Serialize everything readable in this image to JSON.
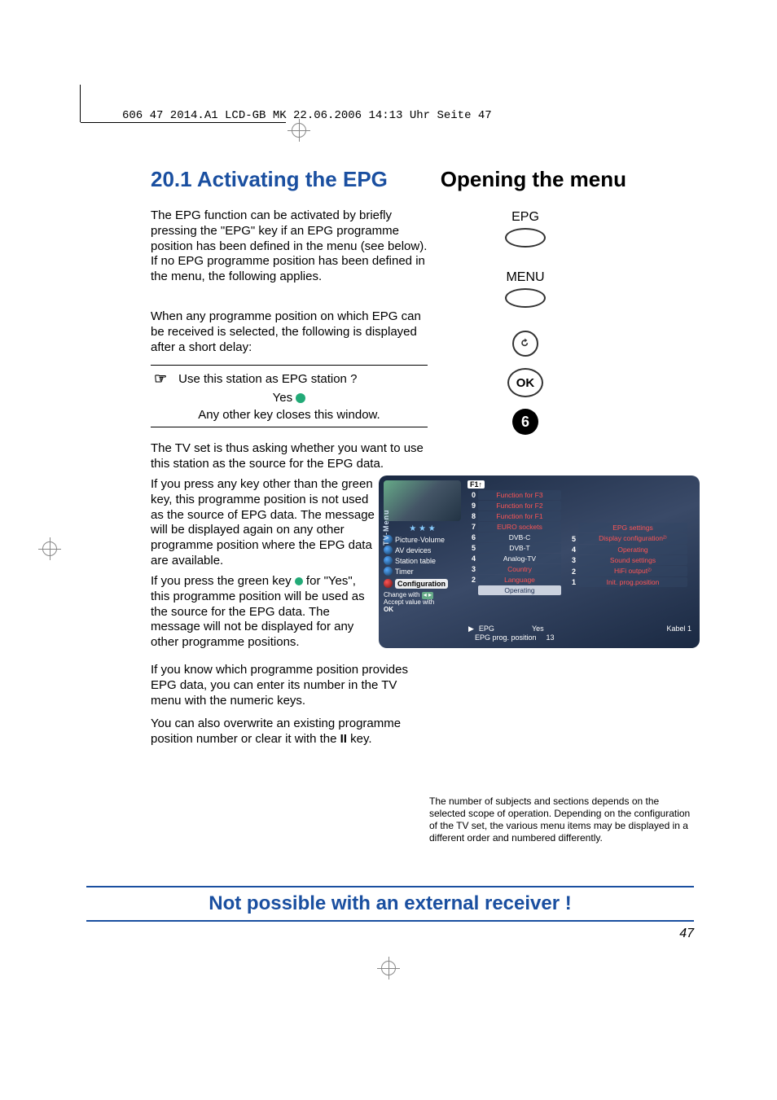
{
  "header_note": "606 47 2014.A1 LCD-GB  MK  22.06.2006  14:13 Uhr  Seite 47",
  "title": {
    "left": "20.1 Activating the EPG",
    "right": "Opening the menu"
  },
  "paragraphs": {
    "p1": "The EPG function can be activated by briefly pressing the \"EPG\" key if an EPG programme position has been defined in the menu (see below). If no EPG programme position has been defined in the menu, the following applies.",
    "p2": "When any programme position on which EPG can be received is selected, the following is displayed after a short delay:",
    "p3": "The TV set is thus asking whether you want to use this station as the source for the EPG data.",
    "p4": "If you press any key other than the green key, this programme position is not used as the source of EPG data. The message will be displayed again on any other programme position where the EPG data are available.",
    "p5_a": "If you press the green key ",
    "p5_b": " for \"Yes\", this programme position will be used as the source for the EPG data. The message will not be displayed for any other programme positions.",
    "p6": "If you know which programme position provides EPG data, you can enter its number in the TV menu with the numeric keys.",
    "p7_a": "You can also overwrite an existing programme position number or clear it with the ",
    "p7_b": "II",
    "p7_c": " key."
  },
  "callout": {
    "line1": "Use this station as EPG station ?",
    "line2": "Yes",
    "line3": "Any other key closes this window."
  },
  "side": {
    "epg_label": "EPG",
    "menu_label": "MENU",
    "ok": "OK",
    "number": "6"
  },
  "tv_menu": {
    "vtext": "TV-Menu",
    "stars": "★ ★ ★",
    "left_items": [
      "Picture·Volume",
      "AV devices",
      "Station table",
      "Timer"
    ],
    "config": "Configuration",
    "change": "Change with",
    "accept": "Accept value with",
    "ok": "OK",
    "f1": "F1",
    "mid": [
      {
        "n": "0",
        "t": "Function for F3",
        "red": true
      },
      {
        "n": "9",
        "t": "Function for F2",
        "red": true
      },
      {
        "n": "8",
        "t": "Function for F1",
        "red": true
      },
      {
        "n": "7",
        "t": "EURO sockets",
        "red": true
      },
      {
        "n": "6",
        "t": "DVB-C",
        "red": false
      },
      {
        "n": "5",
        "t": "DVB-T",
        "red": false
      },
      {
        "n": "4",
        "t": "Analog-TV",
        "red": false
      },
      {
        "n": "3",
        "t": "Country",
        "red": true
      },
      {
        "n": "2",
        "t": "Language",
        "red": true
      },
      {
        "n": "",
        "t": "Operating",
        "sel": true
      }
    ],
    "right": [
      {
        "n": "",
        "t": "EPG settings",
        "red": true
      },
      {
        "n": "5",
        "t": "Display configuration²⁾",
        "red": true
      },
      {
        "n": "4",
        "t": "Operating",
        "red": true
      },
      {
        "n": "3",
        "t": "Sound settings",
        "red": true
      },
      {
        "n": "2",
        "t": "HiFi output²⁾",
        "red": true
      },
      {
        "n": "1",
        "t": "Init. prog.position",
        "red": true
      }
    ],
    "status": {
      "epg_label": "EPG",
      "epg_val": "Yes",
      "pos_label": "EPG prog. position",
      "pos_val": "13",
      "right": "Kabel 1"
    }
  },
  "fine_print": "The number of subjects and sections depends on the selected scope of operation. Depending on the configuration of the TV set, the various menu items may be displayed in a different order and numbered differently.",
  "banner": "Not possible with an external receiver !",
  "page": "47"
}
